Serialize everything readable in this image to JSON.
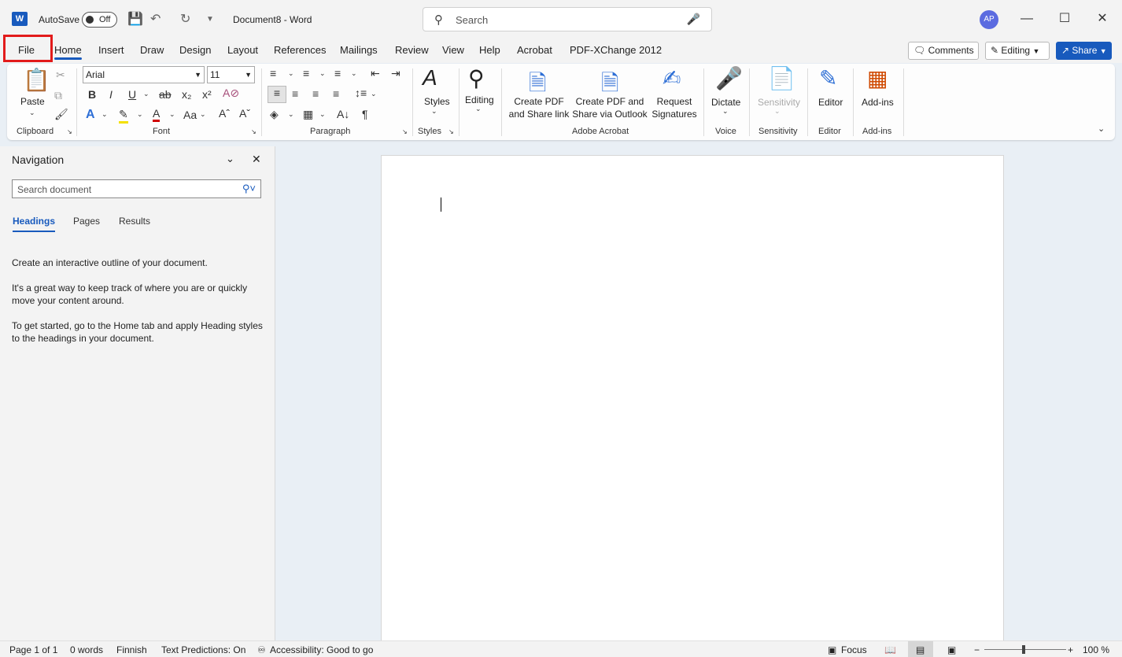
{
  "titlebar": {
    "app_logo": "W",
    "autosave_label": "AutoSave",
    "autosave_state": "Off",
    "doc_title": "Document8  -  Word",
    "search_placeholder": "Search",
    "avatar": "AP",
    "icons": [
      "save-icon",
      "undo-icon",
      "redo-icon",
      "customize-quick-access-icon",
      "search-icon",
      "microphone-icon",
      "minimize-icon",
      "maximize-icon",
      "close-icon"
    ]
  },
  "tabs": [
    "File",
    "Home",
    "Insert",
    "Draw",
    "Design",
    "Layout",
    "References",
    "Mailings",
    "Review",
    "View",
    "Help",
    "Acrobat",
    "PDF-XChange 2012"
  ],
  "header_buttons": {
    "comments": "Comments",
    "editing": "Editing",
    "share": "Share"
  },
  "ribbon": {
    "clipboard": {
      "paste": "Paste",
      "label": "Clipboard"
    },
    "font": {
      "name": "Arial",
      "size": "11",
      "label": "Font"
    },
    "paragraph": {
      "label": "Paragraph"
    },
    "styles": {
      "button": "Styles",
      "label": "Styles"
    },
    "editing": {
      "button": "Editing"
    },
    "adobe": {
      "create_pdf_1": "Create PDF",
      "create_pdf_2": "and Share link",
      "create_pdf_outlook_1": "Create PDF and",
      "create_pdf_outlook_2": "Share via Outlook",
      "request_1": "Request",
      "request_2": "Signatures",
      "label": "Adobe Acrobat"
    },
    "voice": {
      "button": "Dictate",
      "label": "Voice"
    },
    "sensitivity": {
      "button": "Sensitivity",
      "label": "Sensitivity"
    },
    "editor": {
      "button": "Editor",
      "label": "Editor"
    },
    "addins": {
      "button": "Add-ins",
      "label": "Add-ins"
    }
  },
  "navigation": {
    "title": "Navigation",
    "search_placeholder": "Search document",
    "tabs": [
      "Headings",
      "Pages",
      "Results"
    ],
    "p1": "Create an interactive outline of your document.",
    "p2": "It's a great way to keep track of where you are or quickly move your content around.",
    "p3": "To get started, go to the Home tab and apply Heading styles to the headings in your document."
  },
  "status": {
    "page": "Page 1 of 1",
    "words": "0 words",
    "language": "Finnish",
    "predictions": "Text Predictions: On",
    "accessibility": "Accessibility: Good to go",
    "focus": "Focus",
    "zoom": "100 %",
    "zoom_minus": "−",
    "zoom_plus": "+"
  },
  "colors": {
    "accent": "#185abd",
    "highlight_box": "#e21b1b",
    "avatar": "#5b6be0"
  }
}
